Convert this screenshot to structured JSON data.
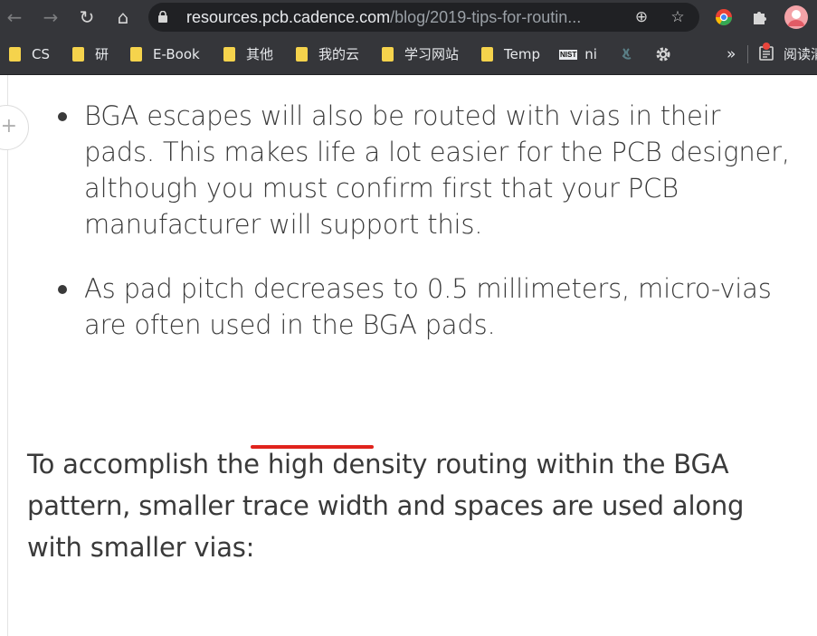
{
  "browser": {
    "url_host": "resources.pcb.cadence.com",
    "url_path": "/blog/2019-tips-for-routin..."
  },
  "bookmarks": [
    {
      "label": "CS"
    },
    {
      "label": "研"
    },
    {
      "label": "E-Book"
    },
    {
      "label": "其他"
    },
    {
      "label": "我的云"
    },
    {
      "label": "学习网站"
    },
    {
      "label": "Temp"
    },
    {
      "label": "ni",
      "icon_text": "NIST"
    }
  ],
  "bookmarks_overflow": "»",
  "reading_list": "阅读清单",
  "article": {
    "bullets": [
      "BGA escapes will also be routed with vias in their pads. This makes life a lot easier for the PCB designer, although you must confirm first that your PCB manufacturer will support this.",
      "As pad pitch decreases to 0.5 millimeters, micro-vias are often used in the BGA pads."
    ],
    "paragraph_before": "To accomplish the high density routing within the BGA pattern, smaller ",
    "paragraph_highlight": "trace width",
    "paragraph_after": " and spaces are used along with smaller vias:"
  },
  "colors": {
    "toolbar": "#35363a",
    "omnibox": "#202124",
    "highlight_underline": "#e0231c",
    "body_text": "#3a3a3a"
  }
}
